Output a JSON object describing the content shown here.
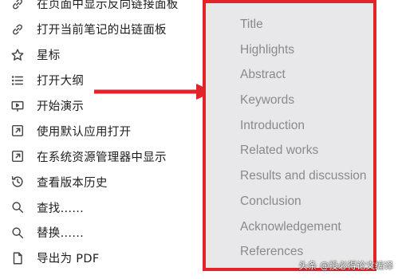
{
  "menu": {
    "items": [
      {
        "label": "在页面中显示反向链接面板",
        "icon": "link-icon"
      },
      {
        "label": "打开当前笔记的出链面板",
        "icon": "link-icon"
      },
      {
        "label": "星标",
        "icon": "star-icon"
      },
      {
        "label": "打开大纲",
        "icon": "list-icon"
      },
      {
        "label": "开始演示",
        "icon": "presentation-icon"
      },
      {
        "label": "使用默认应用打开",
        "icon": "open-external-icon"
      },
      {
        "label": "在系统资源管理器中显示",
        "icon": "open-external-icon"
      },
      {
        "label": "查看版本历史",
        "icon": "history-icon"
      },
      {
        "label": "查找......",
        "icon": "search-icon"
      },
      {
        "label": "替换......",
        "icon": "search-icon"
      },
      {
        "label": "导出为 PDF",
        "icon": "export-pdf-icon"
      }
    ]
  },
  "outline": {
    "items": [
      "Title",
      "Highlights",
      "Abstract",
      "Keywords",
      "Introduction",
      "Related works",
      "Results and discussion",
      "Conclusion",
      "Acknowledgement",
      "References"
    ]
  },
  "watermark": "头条 @投必得论文编译",
  "colors": {
    "highlight_red": "#e3232a",
    "panel_background": "#e8e8ea",
    "outline_text": "#8a8a8a"
  }
}
